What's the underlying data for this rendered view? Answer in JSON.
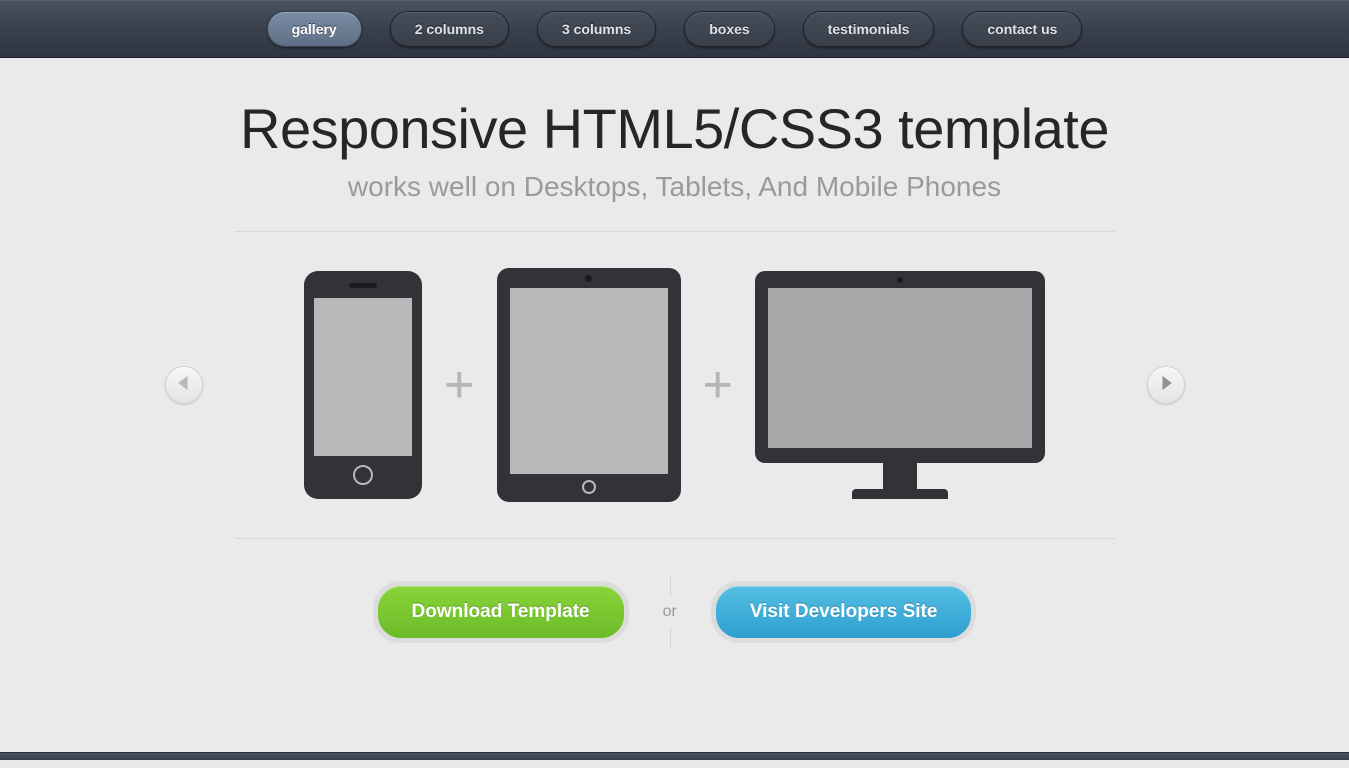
{
  "nav": {
    "items": [
      {
        "label": "gallery",
        "active": true
      },
      {
        "label": "2 columns",
        "active": false
      },
      {
        "label": "3 columns",
        "active": false
      },
      {
        "label": "boxes",
        "active": false
      },
      {
        "label": "testimonials",
        "active": false
      },
      {
        "label": "contact us",
        "active": false
      }
    ]
  },
  "hero": {
    "title": "Responsive HTML5/CSS3 template",
    "subtitle": "works well on Desktops, Tablets, And Mobile Phones"
  },
  "gallery": {
    "separator": "+",
    "devices": [
      "phone",
      "tablet",
      "monitor"
    ]
  },
  "cta": {
    "download_label": "Download Template",
    "or_label": "or",
    "visit_label": "Visit Developers Site"
  },
  "colors": {
    "nav_bg": "#3a414d",
    "green": "#6bbb28",
    "blue": "#2e9fcf",
    "body_bg": "#eaeaea"
  }
}
